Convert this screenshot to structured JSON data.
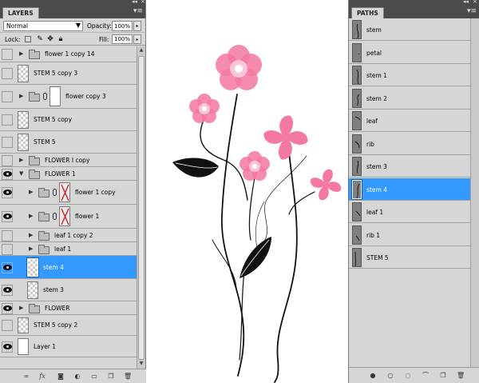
{
  "layers_panel": {
    "tab": "LAYERS",
    "blend_mode": "Normal",
    "opacity_label": "Opacity:",
    "opacity_value": "100%",
    "lock_label": "Lock:",
    "fill_label": "Fill:",
    "fill_value": "100%",
    "layers": [
      {
        "name": "flower 1 copy 14",
        "kind": "group",
        "visible": false,
        "expanded": false,
        "selected": false
      },
      {
        "name": "STEM 5 copy 3",
        "kind": "layer",
        "visible": false,
        "selected": false
      },
      {
        "name": "flower copy 3",
        "kind": "group-mask",
        "visible": false,
        "expanded": false,
        "selected": false
      },
      {
        "name": "STEM 5 copy",
        "kind": "layer",
        "visible": false,
        "selected": false
      },
      {
        "name": "STEM 5",
        "kind": "layer",
        "visible": false,
        "selected": false
      },
      {
        "name": "FLOWER I copy",
        "kind": "group",
        "visible": false,
        "expanded": false,
        "selected": false
      },
      {
        "name": "FLOWER 1",
        "kind": "group",
        "visible": true,
        "expanded": true,
        "selected": false
      },
      {
        "name": "flower 1 copy",
        "kind": "group-mask-x",
        "visible": true,
        "expanded": false,
        "selected": false
      },
      {
        "name": "flower 1",
        "kind": "group-mask-x",
        "visible": true,
        "expanded": false,
        "selected": false
      },
      {
        "name": "leaf 1 copy 2",
        "kind": "group",
        "visible": false,
        "expanded": false,
        "selected": false
      },
      {
        "name": "leaf 1",
        "kind": "group",
        "visible": false,
        "expanded": false,
        "selected": false
      },
      {
        "name": "stem 4",
        "kind": "layer",
        "visible": true,
        "selected": true
      },
      {
        "name": "stem 3",
        "kind": "layer",
        "visible": true,
        "selected": false
      },
      {
        "name": "FLOWER",
        "kind": "group",
        "visible": true,
        "expanded": false,
        "selected": false
      },
      {
        "name": "STEM 5 copy 2",
        "kind": "layer",
        "visible": false,
        "selected": false
      },
      {
        "name": "Layer 1",
        "kind": "layer-white",
        "visible": true,
        "selected": false
      }
    ]
  },
  "paths_panel": {
    "tab": "PATHS",
    "paths": [
      {
        "name": "stem",
        "selected": false
      },
      {
        "name": "petal",
        "selected": false
      },
      {
        "name": "stem 1",
        "selected": false
      },
      {
        "name": "stem 2",
        "selected": false
      },
      {
        "name": "leaf",
        "selected": false
      },
      {
        "name": "rib",
        "selected": false
      },
      {
        "name": "stem 3",
        "selected": false
      },
      {
        "name": "stem 4",
        "selected": true
      },
      {
        "name": "leaf 1",
        "selected": false
      },
      {
        "name": "rib 1",
        "selected": false
      },
      {
        "name": "STEM 5",
        "selected": false
      }
    ]
  },
  "colors": {
    "selection": "#3399ff",
    "panel_bg": "#d6d6d6",
    "panel_header": "#4b4b4b",
    "petal_pink": "#f4789f",
    "flower_center": "#f8c6d8"
  }
}
